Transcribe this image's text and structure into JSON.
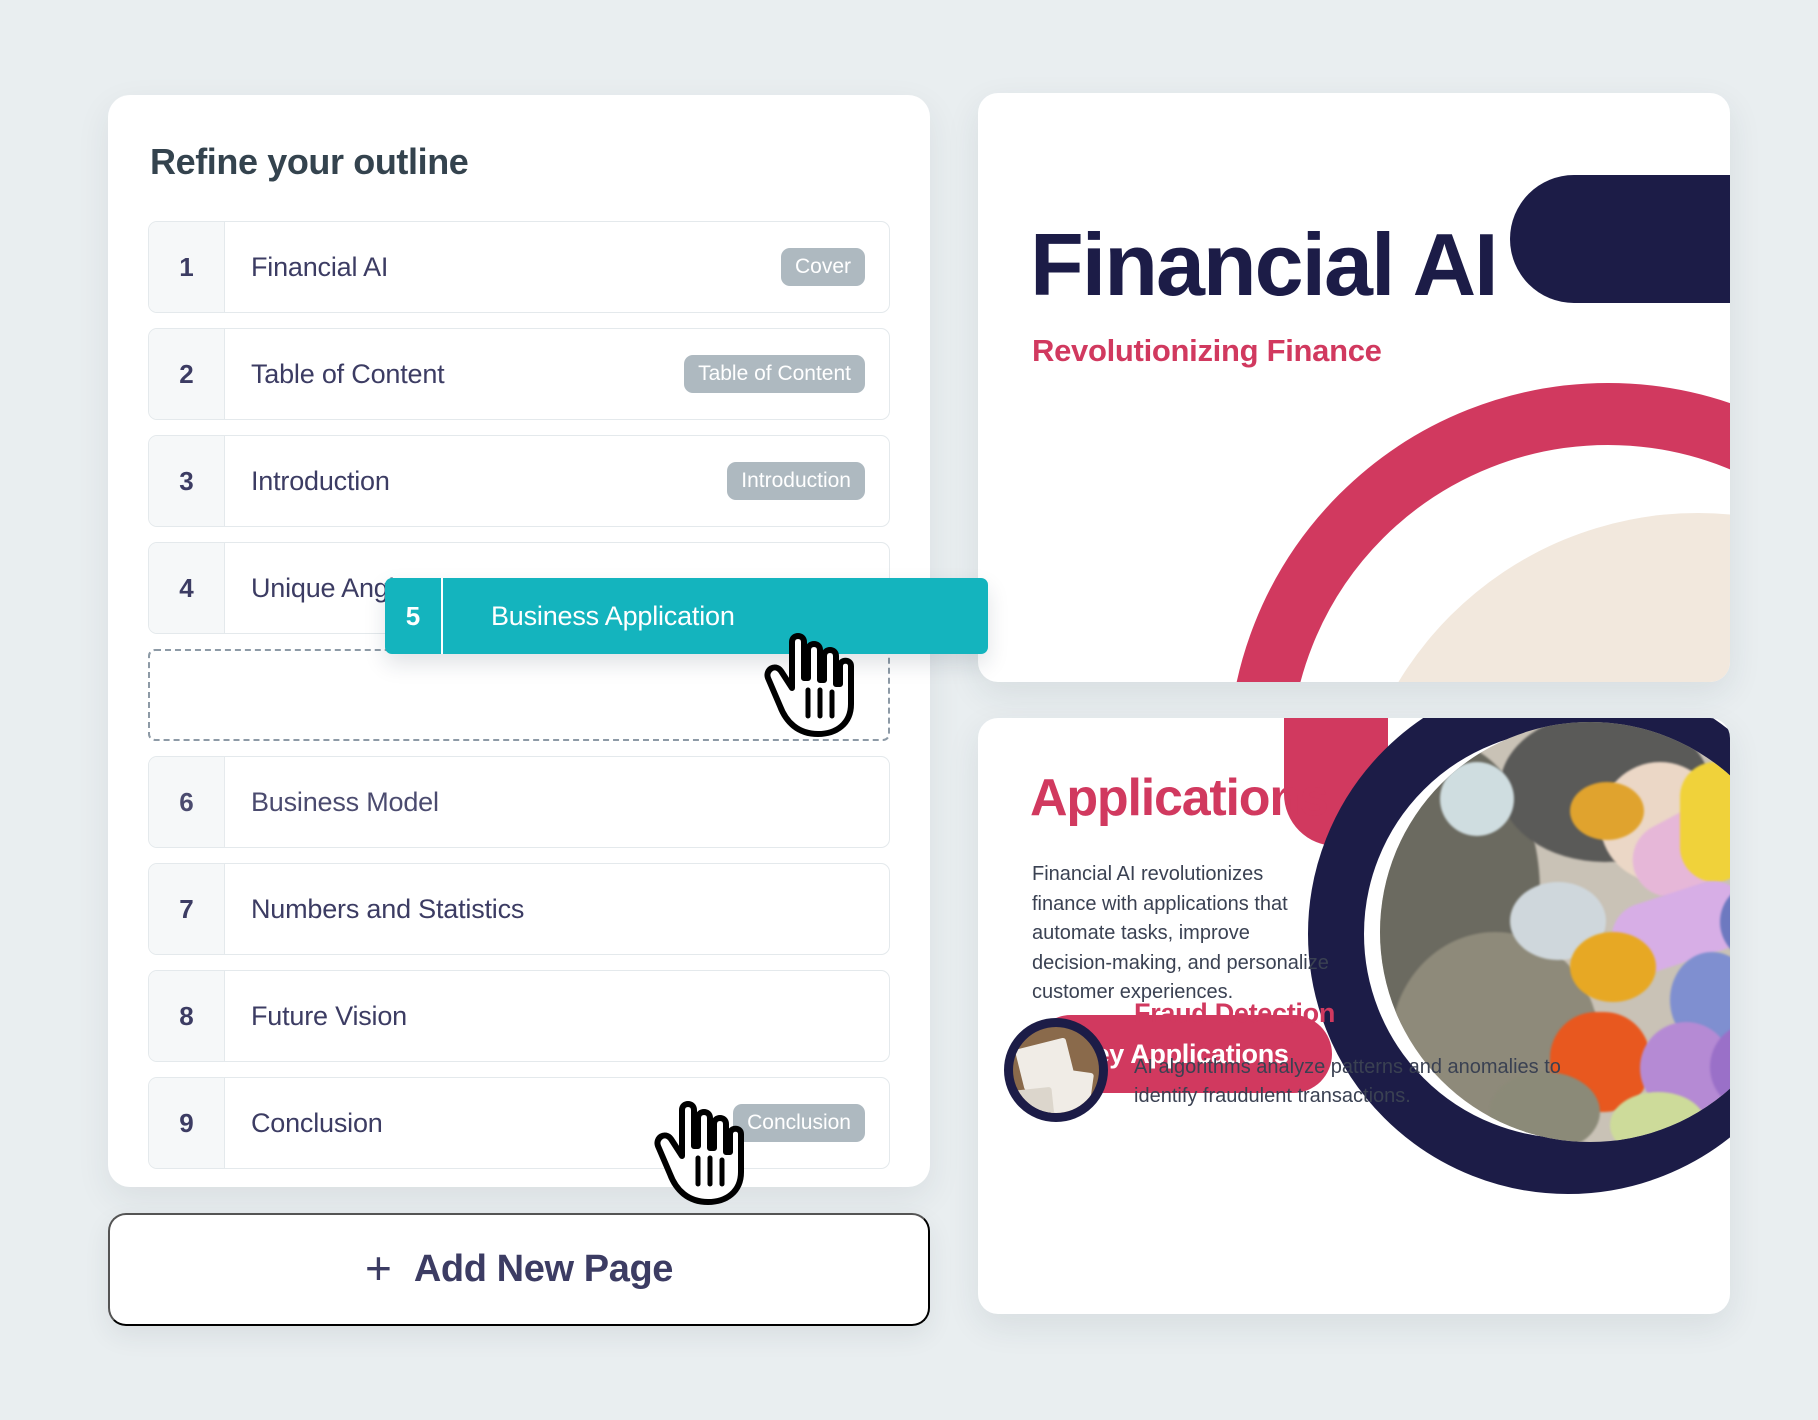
{
  "colors": {
    "page_background": "#e9eef0",
    "teal_accent": "#14b4be",
    "navy": "#1c1c47",
    "crimson": "#d1395f",
    "cream": "#f2e8dd",
    "badge_gray": "#aeb9c0",
    "text_dark": "#3c3c63"
  },
  "outline_panel": {
    "title": "Refine your outline",
    "rows": [
      {
        "number": "1",
        "label": "Financial AI",
        "badge": "Cover"
      },
      {
        "number": "2",
        "label": "Table of Content",
        "badge": "Table of Content"
      },
      {
        "number": "3",
        "label": "Introduction",
        "badge": "Introduction"
      },
      {
        "number": "4",
        "label": "Unique Angle",
        "badge": ""
      },
      {
        "number": "6",
        "label": "Business Model",
        "badge": ""
      },
      {
        "number": "7",
        "label": "Numbers and Statistics",
        "badge": ""
      },
      {
        "number": "8",
        "label": "Future Vision",
        "badge": ""
      },
      {
        "number": "9",
        "label": "Conclusion",
        "badge": "Conclusion"
      }
    ]
  },
  "drag_item": {
    "number": "5",
    "label": "Business Application"
  },
  "add_page_button": {
    "plus_glyph": "+",
    "label": "Add New Page"
  },
  "cursors": {
    "drag_cursor_icon": "pointing-hand-cursor",
    "add_cursor_icon": "pointing-hand-cursor"
  },
  "slides": {
    "cover": {
      "title": "Financial AI",
      "subtitle": "Revolutionizing Finance"
    },
    "applications": {
      "title": "Applications",
      "body": "Financial AI revolutionizes finance with applications that automate tasks, improve decision-making, and personalize customer experiences.",
      "cta_label": "Key Applications",
      "feature_title": "Fraud Detection",
      "feature_body": "AI algorithms analyze patterns and anomalies to identify fraudulent transactions."
    }
  }
}
